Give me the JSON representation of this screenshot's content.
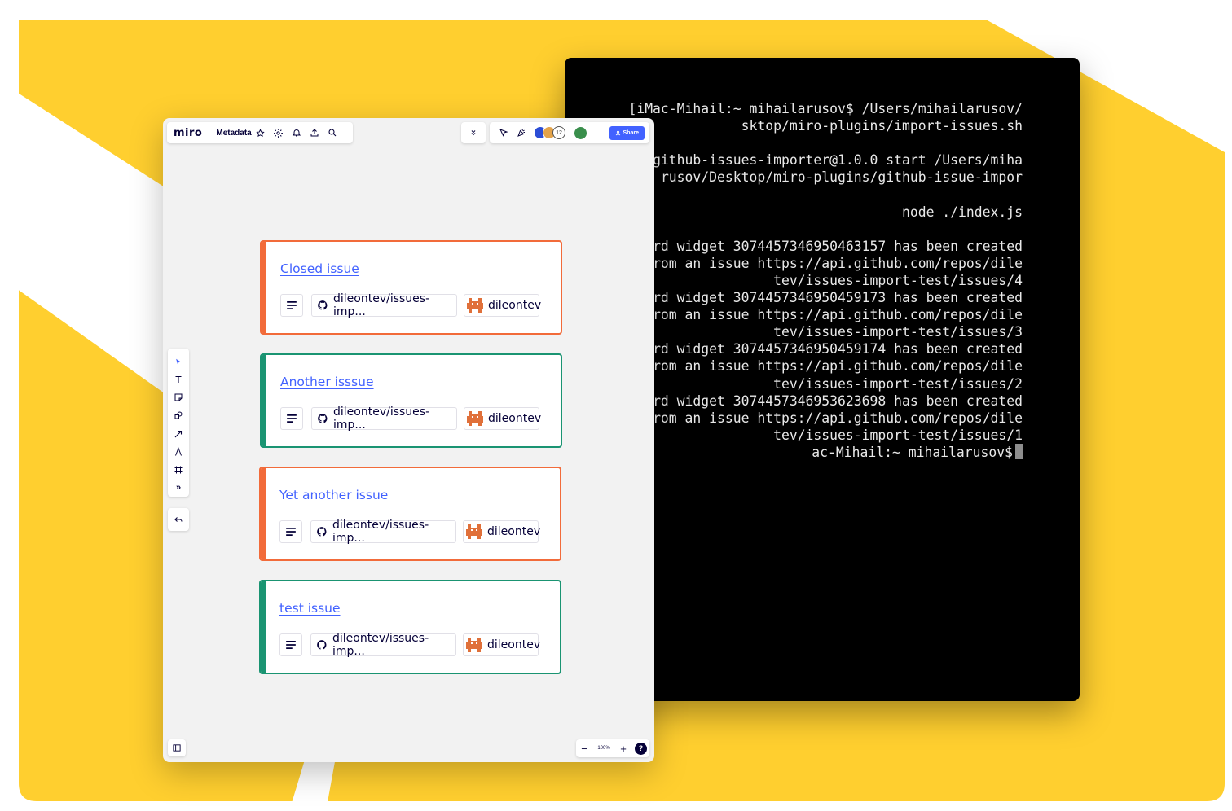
{
  "colors": {
    "background_yellow": "#ffcf2f",
    "miro_blue": "#4262ff",
    "closed_orange": "#f26b3a",
    "open_green": "#1a9472"
  },
  "terminal": {
    "lines": [
      "[iMac-Mihail:~ mihailarusov$ /Users/mihailarusov/",
      "sktop/miro-plugins/import-issues.sh",
      "",
      "github-issues-importer@1.0.0 start /Users/miha",
      "rusov/Desktop/miro-plugins/github-issue-impor",
      "",
      "node ./index.js",
      "",
      "rd widget 3074457346950463157 has been created",
      "rom an issue https://api.github.com/repos/dile",
      "tev/issues-import-test/issues/4",
      "rd widget 3074457346950459173 has been created",
      "rom an issue https://api.github.com/repos/dile",
      "tev/issues-import-test/issues/3",
      "rd widget 3074457346950459174 has been created",
      "rom an issue https://api.github.com/repos/dile",
      "tev/issues-import-test/issues/2",
      "rd widget 3074457346953623698 has been created",
      "rom an issue https://api.github.com/repos/dile",
      "tev/issues-import-test/issues/1",
      "ac-Mihail:~ mihailarusov$"
    ]
  },
  "miro": {
    "logo": "miro",
    "board_name": "Metadata",
    "share_label": "Share",
    "collaborator_count": "12",
    "zoom_level": "100%",
    "help_label": "?",
    "tools": [
      "select-tool",
      "text-tool",
      "sticky-note-tool",
      "shapes-tool",
      "connection-line-tool",
      "pen-tool",
      "frame-tool",
      "more-tools"
    ],
    "more_tools_glyph": "»",
    "zoom_out_glyph": "−",
    "zoom_in_glyph": "+"
  },
  "cards": [
    {
      "title": "Closed issue",
      "repo": "dileontev/issues-imp...",
      "user": "dileontev",
      "status": "closed"
    },
    {
      "title": "Another isssue",
      "repo": "dileontev/issues-imp...",
      "user": "dileontev",
      "status": "open"
    },
    {
      "title": "Yet another issue",
      "repo": "dileontev/issues-imp...",
      "user": "dileontev",
      "status": "closed"
    },
    {
      "title": "test issue",
      "repo": "dileontev/issues-imp...",
      "user": "dileontev",
      "status": "open"
    }
  ]
}
